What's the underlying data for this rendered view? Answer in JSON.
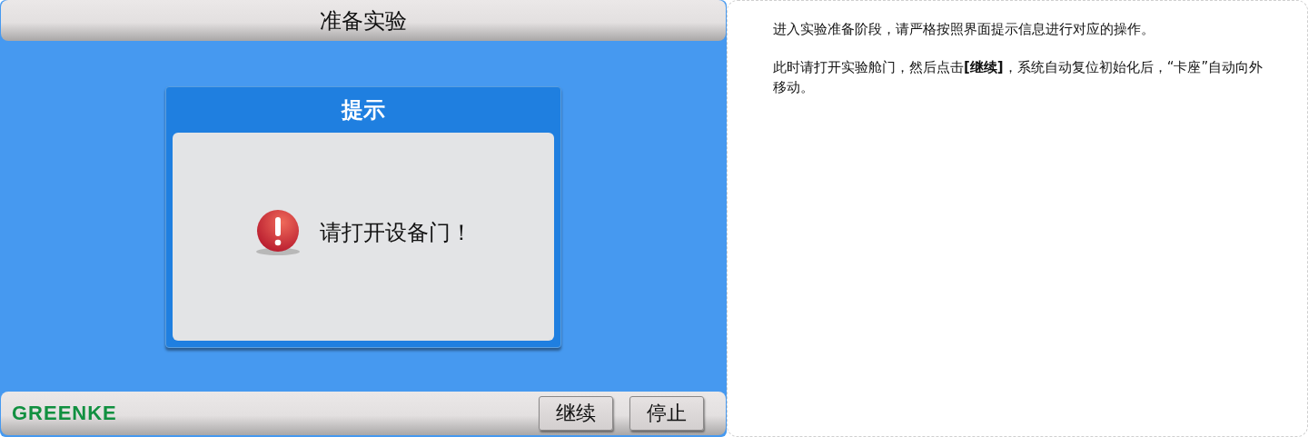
{
  "screen": {
    "title": "准备实验",
    "dialog": {
      "title": "提示",
      "message": "请打开设备门！"
    },
    "logo": "GREENKE",
    "buttons": [
      "继续",
      "停止"
    ]
  },
  "notes": [
    "进入实验准备阶段，请严格按照界面提示信息进行对应的操作。",
    "此时请打开实验舱门，然后点击**[继续]**，系统自动复位初始化后，“卡座”自动向外移动。"
  ]
}
